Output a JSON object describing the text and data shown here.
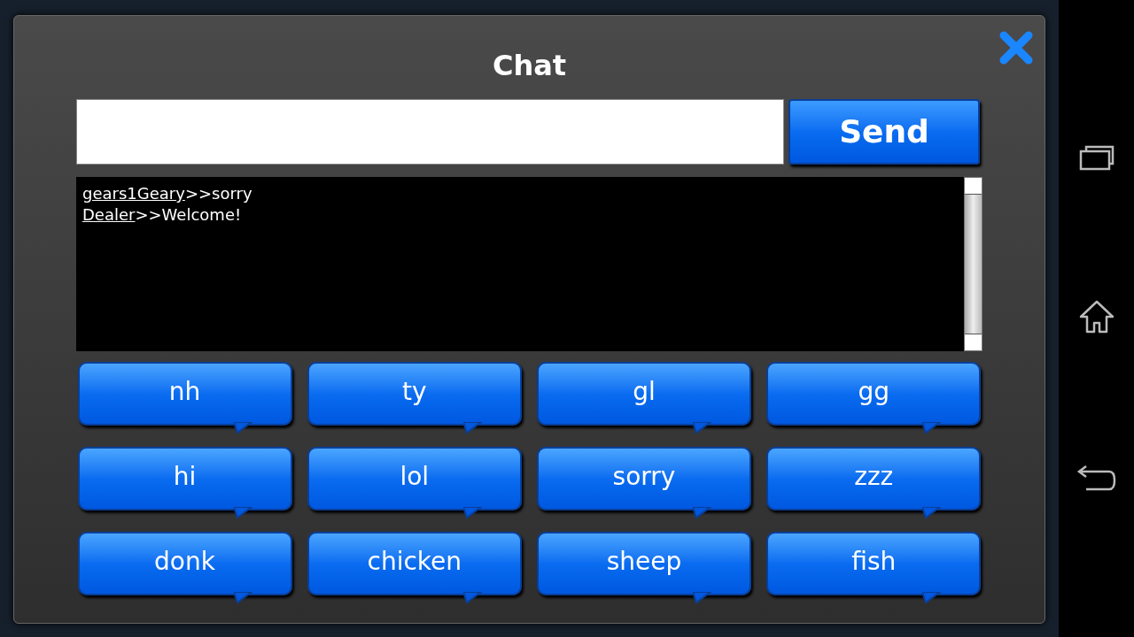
{
  "dialog": {
    "title": "Chat",
    "send_button": "Send",
    "messages": [
      {
        "sender": "gears1Geary",
        "text": ">>sorry"
      },
      {
        "sender": "Dealer",
        "text": ">>Welcome!"
      }
    ],
    "quick_replies": [
      "nh",
      "ty",
      "gl",
      "gg",
      "hi",
      "lol",
      "sorry",
      "zzz",
      "donk",
      "chicken",
      "sheep",
      "fish"
    ]
  }
}
